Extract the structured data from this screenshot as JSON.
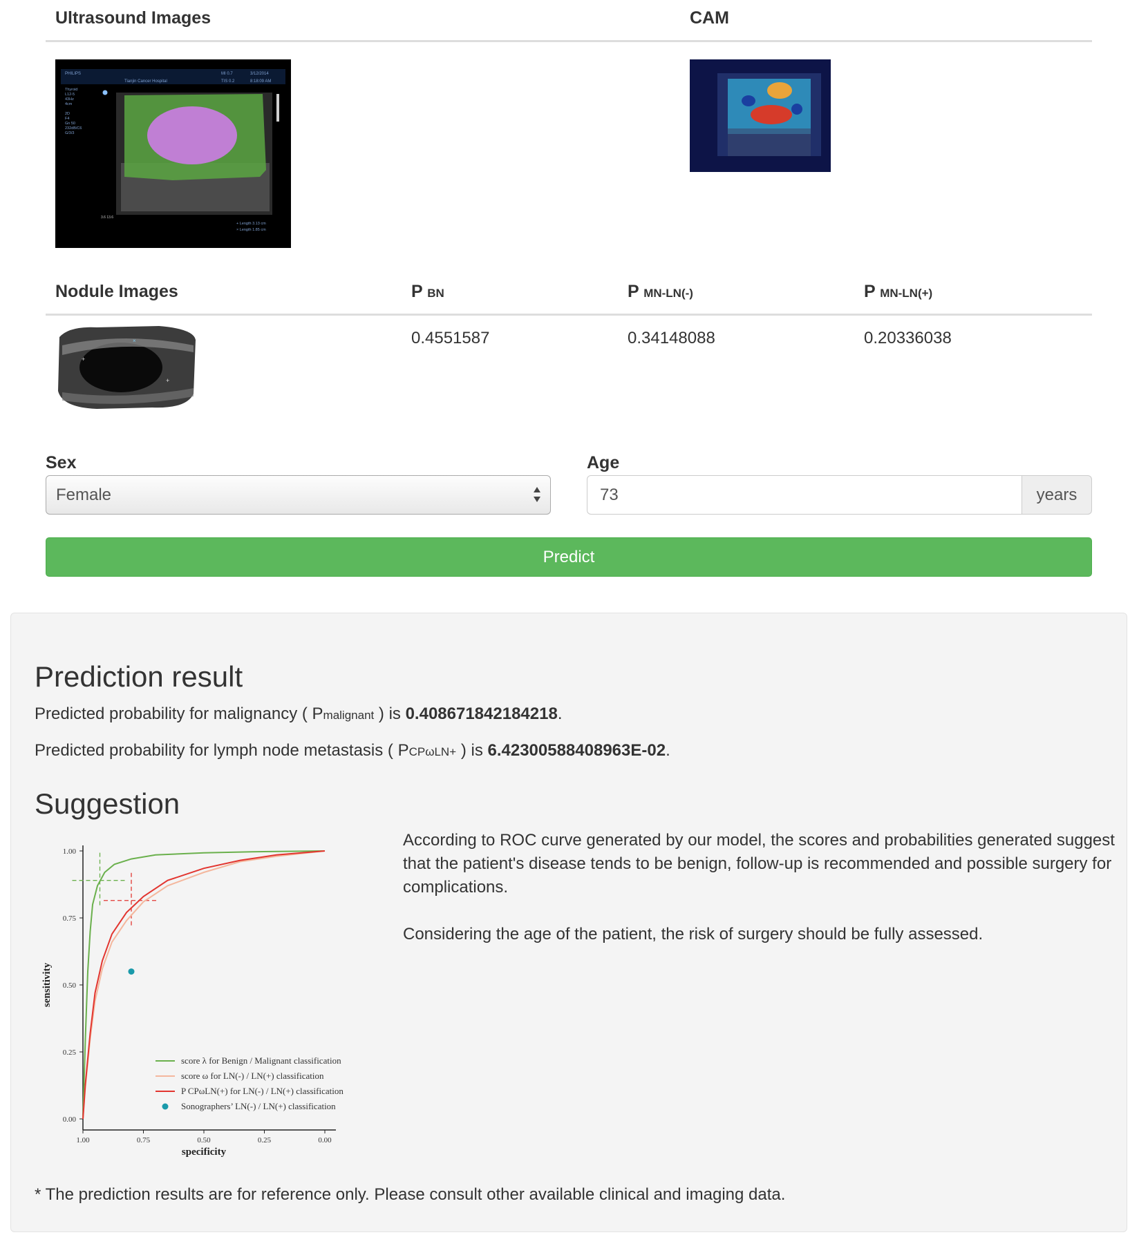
{
  "top_table": {
    "col_ultrasound": "Ultrasound Images",
    "col_cam": "CAM",
    "us_overlay": {
      "brand": "PHILIPS",
      "hospital": "Tianjin Cancer Hospital",
      "mi": "MI 0.7",
      "date": "3/12/2014",
      "tis": "TIS 0.2",
      "time": "8:18:09 AM",
      "params": [
        "Thyroid",
        "L12-5",
        "43Hz",
        "4cm",
        "",
        "2D",
        "F4",
        "Gn 50",
        "232dB/C6",
        "G/3/3"
      ],
      "length1": "+ Length  3.13 cm",
      "length2": "× Length  1.85 cm",
      "depth_marker": "3.6  13.6"
    }
  },
  "nodule_table": {
    "col_nodule": "Nodule Images",
    "col_pbn": "P",
    "col_pbn_sub": "BN",
    "col_pmn_neg": "P",
    "col_pmn_neg_sub": "MN-LN(-)",
    "col_pmn_pos": "P",
    "col_pmn_pos_sub": "MN-LN(+)",
    "row": {
      "pbn": "0.4551587",
      "pmn_neg": "0.34148088",
      "pmn_pos": "0.20336038"
    }
  },
  "form": {
    "sex_label": "Sex",
    "sex_value": "Female",
    "age_label": "Age",
    "age_value": "73",
    "age_unit": "years",
    "predict_label": "Predict"
  },
  "result": {
    "heading": "Prediction result",
    "malig_prefix": "Predicted probability for malignancy ( P",
    "malig_sub": "malignant",
    "malig_mid": " ) is ",
    "malig_value": "0.408671842184218",
    "lymph_prefix": "Predicted probability for lymph node metastasis ( P",
    "lymph_sub": "CPωLN+",
    "lymph_mid": " ) is ",
    "lymph_value": "6.42300588408963E-02",
    "period": "."
  },
  "suggestion": {
    "heading": "Suggestion",
    "para1": "According to ROC curve generated by our model, the scores and probabilities generated suggest that the patient's disease tends to be benign, follow-up is recommended and possible surgery for complications.",
    "para2": "Considering the age of the patient, the risk of surgery should be fully assessed.",
    "footnote": "* The prediction results are for reference only. Please consult other available clinical and imaging data."
  },
  "chart_data": {
    "type": "line",
    "xlabel": "specificity",
    "ylabel": "sensitivity",
    "xlim": [
      1.0,
      0.0
    ],
    "ylim": [
      0.0,
      1.0
    ],
    "x_ticks": [
      "1.00",
      "0.75",
      "0.50",
      "0.25",
      "0.00"
    ],
    "y_ticks": [
      "0.00",
      "0.25",
      "0.50",
      "0.75",
      "1.00"
    ],
    "legend_position": "bottom-right",
    "series": [
      {
        "name": "score λ for Benign / Malignant classification",
        "color": "#6ab04c",
        "points": [
          [
            1.0,
            0.0
          ],
          [
            0.99,
            0.3
          ],
          [
            0.98,
            0.55
          ],
          [
            0.97,
            0.7
          ],
          [
            0.96,
            0.8
          ],
          [
            0.94,
            0.87
          ],
          [
            0.91,
            0.92
          ],
          [
            0.87,
            0.95
          ],
          [
            0.8,
            0.97
          ],
          [
            0.7,
            0.985
          ],
          [
            0.5,
            0.993
          ],
          [
            0.3,
            0.997
          ],
          [
            0.0,
            1.0
          ]
        ]
      },
      {
        "name": "score ω for LN(-) / LN(+) classification",
        "color": "#f4b79d",
        "points": [
          [
            1.0,
            0.0
          ],
          [
            0.99,
            0.12
          ],
          [
            0.97,
            0.3
          ],
          [
            0.95,
            0.44
          ],
          [
            0.92,
            0.56
          ],
          [
            0.88,
            0.66
          ],
          [
            0.82,
            0.74
          ],
          [
            0.75,
            0.81
          ],
          [
            0.65,
            0.87
          ],
          [
            0.5,
            0.92
          ],
          [
            0.35,
            0.96
          ],
          [
            0.2,
            0.98
          ],
          [
            0.0,
            1.0
          ]
        ]
      },
      {
        "name": "P CPωLN(+) for LN(-) / LN(+) classification",
        "color": "#e2352f",
        "points": [
          [
            1.0,
            0.0
          ],
          [
            0.99,
            0.13
          ],
          [
            0.97,
            0.32
          ],
          [
            0.95,
            0.47
          ],
          [
            0.92,
            0.59
          ],
          [
            0.88,
            0.69
          ],
          [
            0.82,
            0.77
          ],
          [
            0.75,
            0.83
          ],
          [
            0.65,
            0.89
          ],
          [
            0.5,
            0.935
          ],
          [
            0.35,
            0.965
          ],
          [
            0.2,
            0.985
          ],
          [
            0.0,
            1.0
          ]
        ]
      }
    ],
    "point_series": {
      "name": "Sonographers’ LN(-) / LN(+) classification",
      "color": "#1a9aaa",
      "points": [
        [
          0.8,
          0.55
        ]
      ]
    },
    "crosshairs": [
      {
        "x": 0.93,
        "y": 0.89,
        "color": "#6ab04c"
      },
      {
        "x": 0.8,
        "y": 0.815,
        "color": "#e2352f"
      }
    ]
  }
}
